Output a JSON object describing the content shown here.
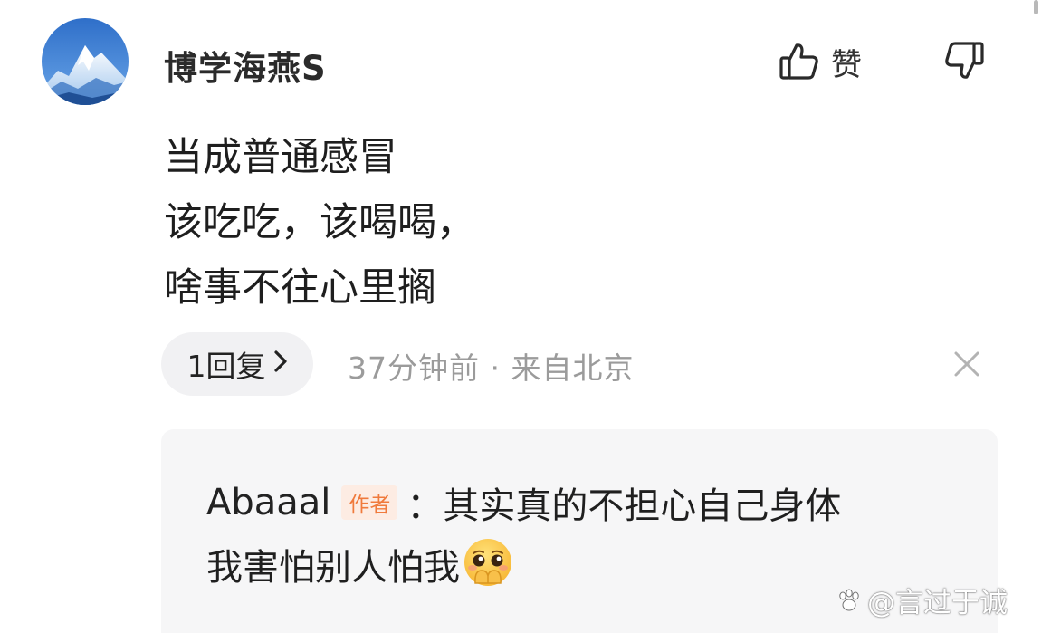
{
  "comment": {
    "username": "博学海燕S",
    "like_label": "赞",
    "lines": [
      "当成普通感冒",
      "该吃吃，该喝喝，",
      "啥事不往心里搁"
    ],
    "reply_count_label": "1回复",
    "meta": "37分钟前 · 来自北京"
  },
  "reply": {
    "author": "Abaaal",
    "author_badge": "作者",
    "line1": "：其实真的不担心自己身体",
    "line2": "我害怕别人怕我",
    "emoji": "pleading-hands-covering-mouth-emoji"
  },
  "watermark": {
    "text": "@言过于诚"
  },
  "icons": {
    "like": "thumbs-up-icon",
    "dislike": "thumbs-down-icon",
    "chevron": "chevron-right-icon",
    "close": "close-icon"
  },
  "colors": {
    "meta_text": "#9b9b9b",
    "badge_text": "#f07a3c",
    "badge_bg": "#fdece3",
    "reply_bg": "#f6f6f7",
    "pill_bg": "#f1f1f3"
  }
}
